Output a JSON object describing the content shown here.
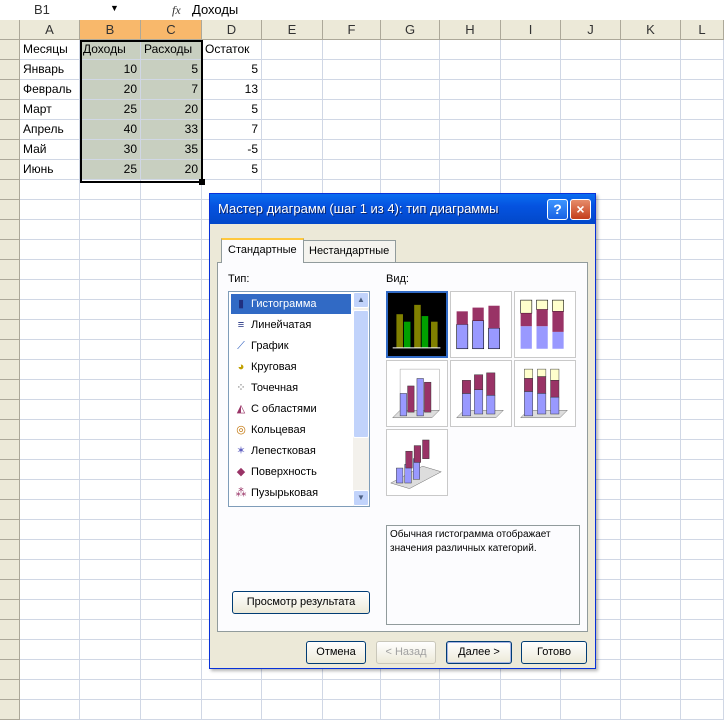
{
  "formula_bar": {
    "cell_ref": "B1",
    "fx": "fx",
    "value": "Доходы"
  },
  "columns": [
    "A",
    "B",
    "C",
    "D",
    "E",
    "F",
    "G",
    "H",
    "I",
    "J",
    "K",
    "L"
  ],
  "sheet": {
    "header": [
      "Месяцы",
      "Доходы",
      "Расходы",
      "Остаток"
    ],
    "rows": [
      [
        "Январь",
        "10",
        "5",
        "5"
      ],
      [
        "Февраль",
        "20",
        "7",
        "13"
      ],
      [
        "Март",
        "25",
        "20",
        "5"
      ],
      [
        "Апрель",
        "40",
        "33",
        "7"
      ],
      [
        "Май",
        "30",
        "35",
        "-5"
      ],
      [
        "Июнь",
        "25",
        "20",
        "5"
      ]
    ]
  },
  "dialog": {
    "title": "Мастер диаграмм (шаг 1 из 4): тип диаграммы",
    "help": "?",
    "close": "×",
    "tabs": [
      "Стандартные",
      "Нестандартные"
    ],
    "type_label": "Тип:",
    "view_label": "Вид:",
    "types": [
      {
        "label": "Гистограмма",
        "icon": "histogram-icon"
      },
      {
        "label": "Линейчатая",
        "icon": "bar-chart-icon"
      },
      {
        "label": "График",
        "icon": "line-chart-icon"
      },
      {
        "label": "Круговая",
        "icon": "pie-chart-icon"
      },
      {
        "label": "Точечная",
        "icon": "scatter-chart-icon"
      },
      {
        "label": "С областями",
        "icon": "area-chart-icon"
      },
      {
        "label": "Кольцевая",
        "icon": "donut-chart-icon"
      },
      {
        "label": "Лепестковая",
        "icon": "radar-chart-icon"
      },
      {
        "label": "Поверхность",
        "icon": "surface-chart-icon"
      },
      {
        "label": "Пузырьковая",
        "icon": "bubble-chart-icon"
      }
    ],
    "description": "Обычная гистограмма отображает значения различных категорий.",
    "preview_button": "Просмотр результата",
    "buttons": {
      "cancel": "Отмена",
      "back": "< Назад",
      "next": "Далее >",
      "finish": "Готово"
    },
    "colors": {
      "blue": "#9999ff",
      "maroon": "#993366",
      "cream": "#ffffcc",
      "olive": "#808000",
      "green": "#00a000"
    }
  }
}
